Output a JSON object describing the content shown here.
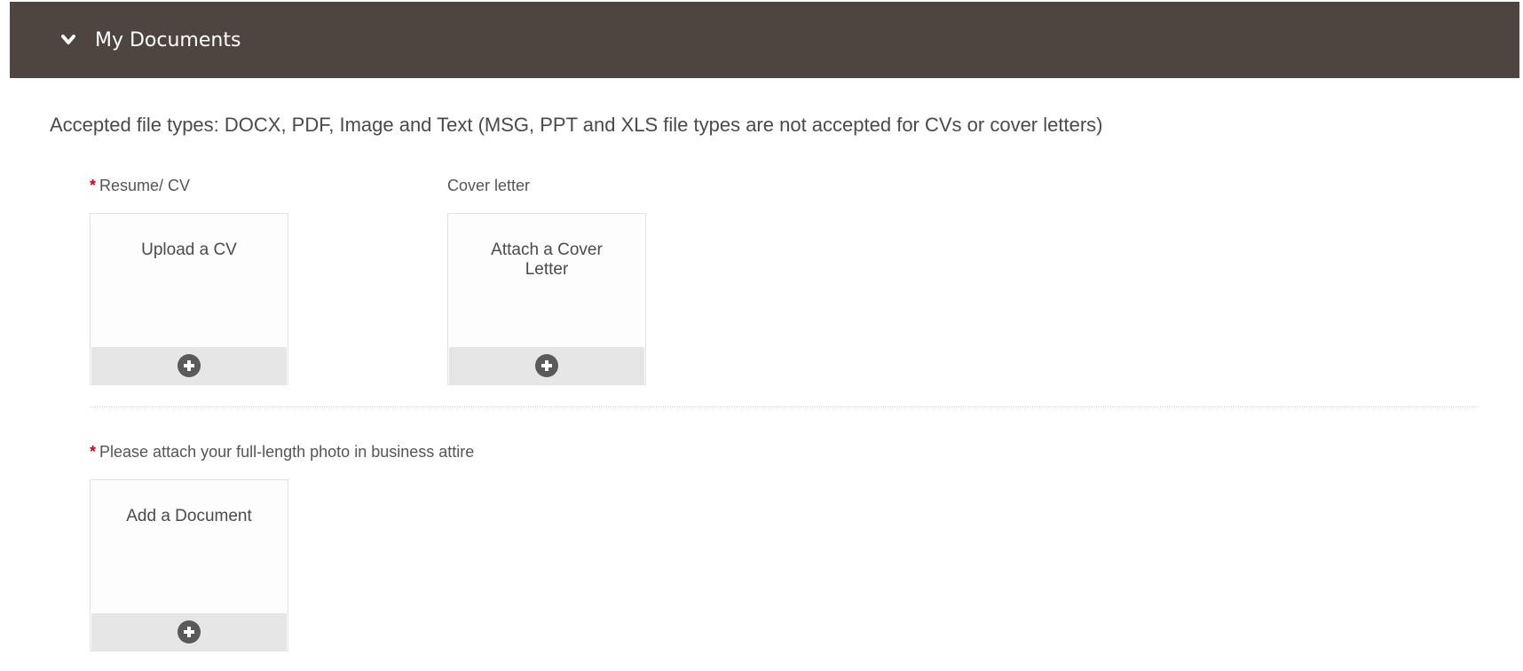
{
  "header": {
    "title": "My Documents",
    "icon": "chevron-down-icon",
    "bg_color": "#4e4540"
  },
  "accepted_text": "Accepted file types: DOCX, PDF, Image and Text (MSG, PPT and XLS file types are not accepted for CVs or cover letters)",
  "required_marker": "*",
  "sections": {
    "resume": {
      "label": "Resume/ CV",
      "required": true,
      "tile_text": "Upload a CV",
      "icon": "plus-circle-icon"
    },
    "cover_letter": {
      "label": "Cover letter",
      "required": false,
      "tile_text": "Attach a Cover Letter",
      "icon": "plus-circle-icon"
    },
    "photo": {
      "label": "Please attach your full-length photo in business attire",
      "required": true,
      "tile_text": "Add a Document",
      "icon": "plus-circle-icon"
    }
  },
  "colors": {
    "required": "#d0021b",
    "tile_bar": "#e6e6e6",
    "plus_icon": "#5a5a5a"
  }
}
